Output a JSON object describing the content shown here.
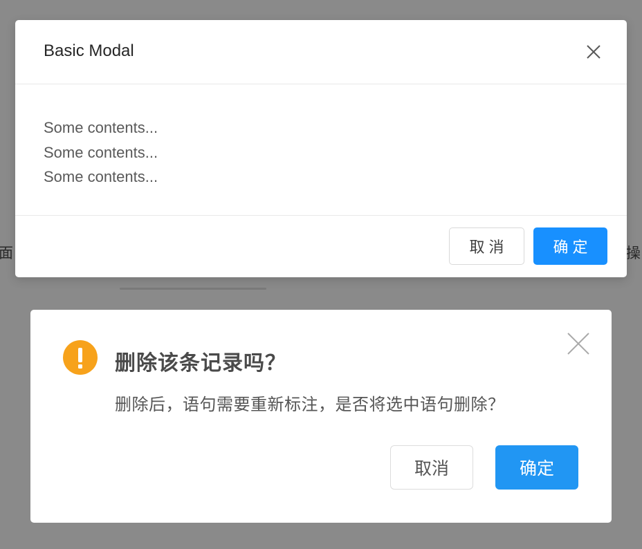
{
  "background": {
    "left_text": "面",
    "right_text": "操"
  },
  "basic_modal": {
    "title": "Basic Modal",
    "close_icon": "close-icon",
    "contents": [
      "Some contents...",
      "Some contents...",
      "Some contents..."
    ],
    "cancel_label": "取消",
    "ok_label": "确定",
    "accent_color": "#1890ff"
  },
  "confirm_dialog": {
    "icon": "warning-icon",
    "icon_color": "#f7a21b",
    "title": "删除该条记录吗？",
    "message": "删除后，语句需要重新标注，是否将选中语句删除？",
    "close_icon": "close-icon",
    "cancel_label": "取消",
    "ok_label": "确定",
    "accent_color": "#2196f3"
  }
}
